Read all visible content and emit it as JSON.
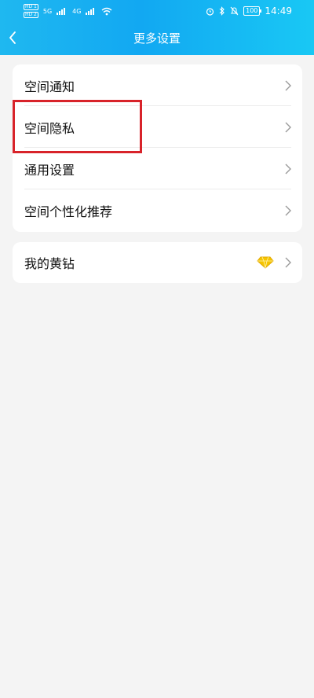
{
  "status_bar": {
    "hd_top": "HD 1",
    "hd_bottom": "HD 2",
    "net1": "5G",
    "net2": "4G",
    "battery": "100",
    "time": "14:49"
  },
  "header": {
    "title": "更多设置"
  },
  "groups": {
    "main": {
      "items": [
        {
          "label": "空间通知"
        },
        {
          "label": "空间隐私"
        },
        {
          "label": "通用设置"
        },
        {
          "label": "空间个性化推荐"
        }
      ]
    },
    "vip": {
      "label": "我的黄钻"
    }
  },
  "colors": {
    "header_gradient_start": "#1fb8f0",
    "header_gradient_end": "#19c8f4",
    "page_bg": "#f4f4f4",
    "highlight_box": "#d8232a",
    "diamond": "#f5c400"
  },
  "icons": [
    "back-arrow-icon",
    "chevron-right-icon",
    "yellow-diamond-icon",
    "wifi-icon",
    "alarm-icon",
    "bluetooth-icon",
    "mute-icon",
    "battery-icon"
  ]
}
